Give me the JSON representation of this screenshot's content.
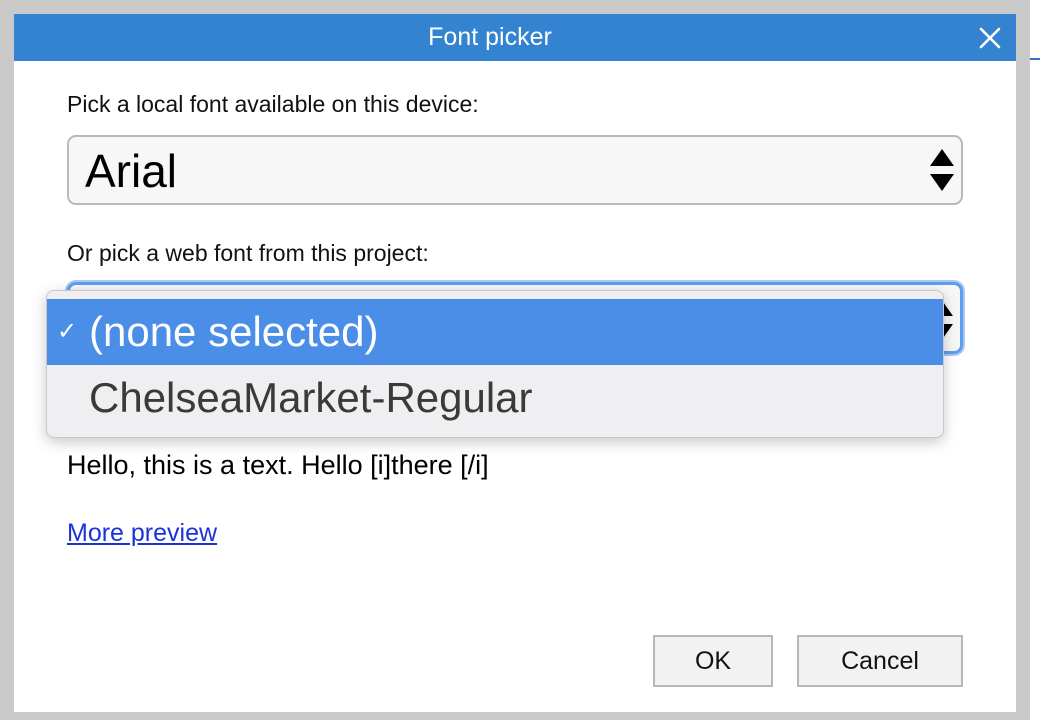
{
  "dialog": {
    "title": "Font picker"
  },
  "local_font": {
    "label": "Pick a local font available on this device:",
    "selected": "Arial"
  },
  "web_font": {
    "label": "Or pick a web font from this project:",
    "options": [
      {
        "label": "(none selected)",
        "selected": true
      },
      {
        "label": "ChelseaMarket-Regular",
        "selected": false
      }
    ]
  },
  "preview": {
    "text": "Hello, this is a text. Hello [i]there [/i]",
    "more_link": "More preview"
  },
  "buttons": {
    "ok": "OK",
    "cancel": "Cancel"
  },
  "icons": {
    "close": "close-icon",
    "select_arrows": "up-down-arrows-icon",
    "check": "checkmark-icon"
  },
  "colors": {
    "titlebar": "#3483d0",
    "selected_option": "#4a8ee8",
    "link": "#1a33d8",
    "focus_ring": "#5f9ded"
  }
}
